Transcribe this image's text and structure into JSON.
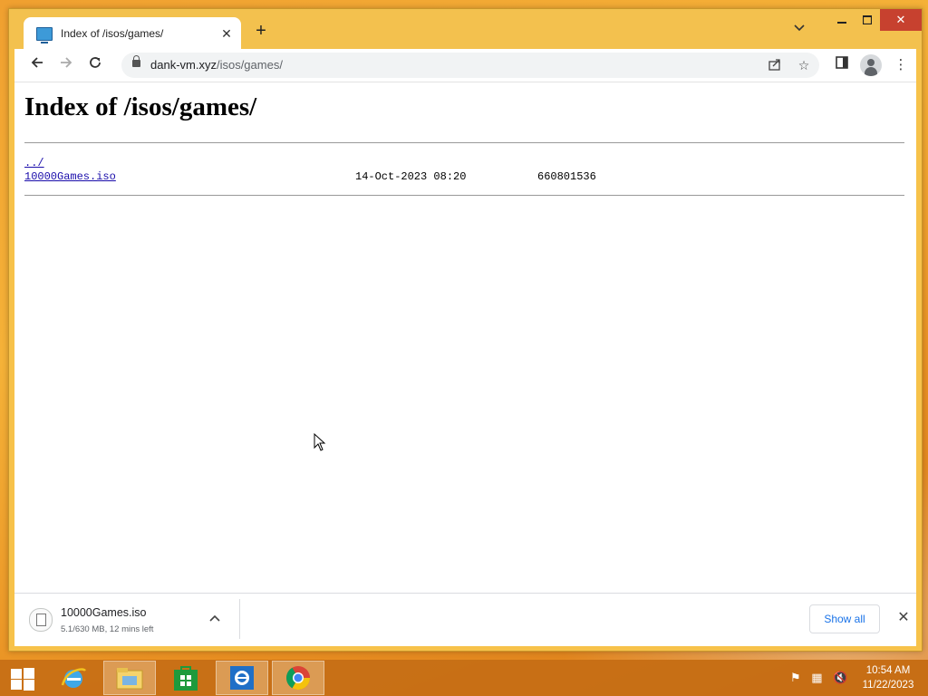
{
  "browser": {
    "tab": {
      "title": "Index of /isos/games/"
    },
    "url": {
      "host": "dank-vm.xyz",
      "path": "/isos/games/"
    },
    "icons": {
      "favicon": "monitor-icon",
      "back": "arrow-left-icon",
      "forward": "arrow-right-icon",
      "reload": "reload-icon",
      "share": "share-icon",
      "bookmark": "star-icon",
      "side_panel": "side-panel-icon",
      "profile": "profile-icon",
      "menu": "kebab-menu-icon"
    }
  },
  "page": {
    "heading": "Index of /isos/games/",
    "parent_link": "../",
    "entries": [
      {
        "name": "10000Games.iso",
        "date": "14-Oct-2023 08:20",
        "size": "660801536"
      }
    ]
  },
  "download_bar": {
    "file_name": "10000Games.iso",
    "status": "5.1/630 MB, 12 mins left",
    "show_all_label": "Show all"
  },
  "taskbar": {
    "apps": [
      "internet-explorer",
      "file-explorer",
      "store",
      "internet-explorer-alt",
      "chrome"
    ],
    "active_app": "chrome",
    "time": "10:54 AM",
    "date": "11/22/2023"
  },
  "colors": {
    "desktop": "#f0a030",
    "window_frame": "#f3c14e",
    "close_button": "#c7412f",
    "link": "#1a0dab",
    "accent_blue": "#1a73e8"
  }
}
